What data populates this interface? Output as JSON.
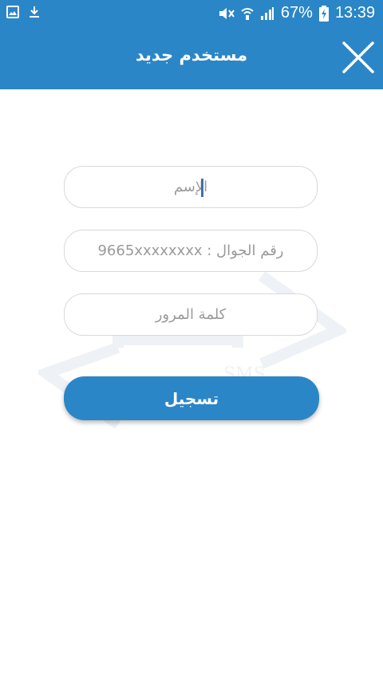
{
  "status_bar": {
    "battery_percent": "67%",
    "time": "13:39",
    "icons": [
      "image-icon",
      "download-icon",
      "mute-icon",
      "wifi-icon",
      "signal-icon",
      "battery-charging-icon"
    ]
  },
  "header": {
    "title": "مستخدم جديد",
    "close_icon": "close-icon",
    "background": "#2a86c7"
  },
  "form": {
    "name_placeholder": "الإسم",
    "phone_placeholder": "رقم الجوال : 9665xxxxxxxx",
    "password_placeholder": "كلمة المرور",
    "submit_label": "تسجيل"
  },
  "watermark": {
    "text": "SMS"
  },
  "colors": {
    "accent": "#2a86c7",
    "field_border": "#d9d9d9",
    "placeholder": "#9a9a9a"
  }
}
